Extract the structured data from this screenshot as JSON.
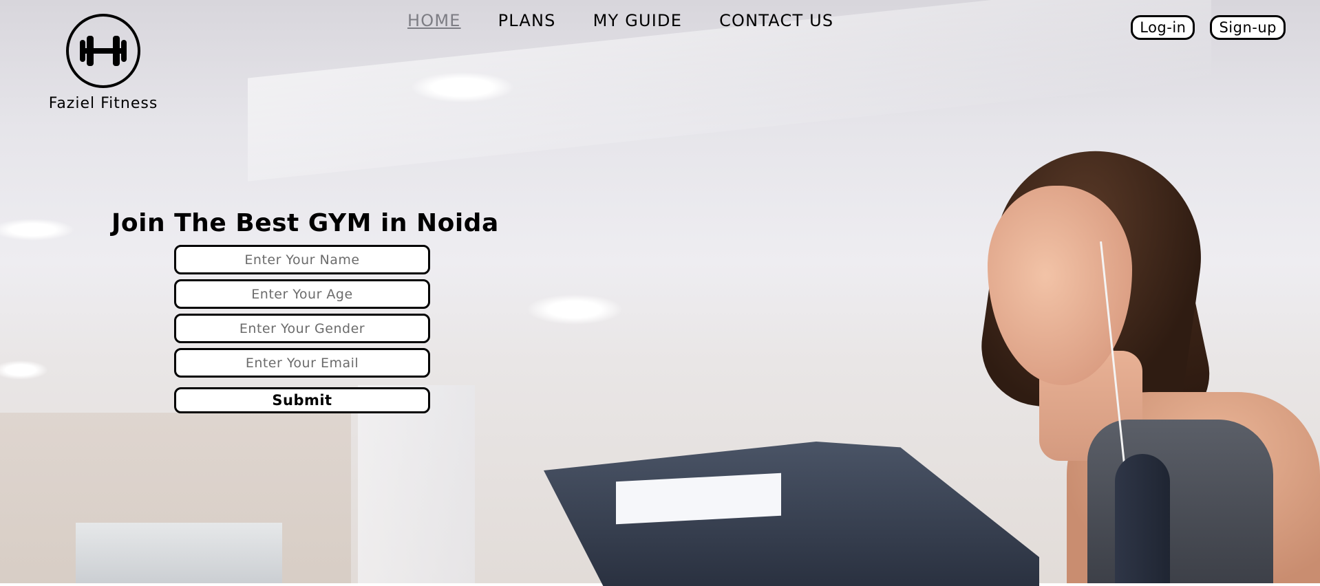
{
  "brand": {
    "name": "Faziel Fitness",
    "icon": "dumbbell-icon"
  },
  "nav": {
    "items": [
      {
        "label": "HOME",
        "active": true
      },
      {
        "label": "PLANS",
        "active": false
      },
      {
        "label": "MY GUIDE",
        "active": false
      },
      {
        "label": "CONTACT US",
        "active": false
      }
    ]
  },
  "auth": {
    "login_label": "Log-in",
    "signup_label": "Sign-up"
  },
  "hero": {
    "headline": "Join The Best GYM in Noida"
  },
  "form": {
    "name_placeholder": "Enter Your Name",
    "age_placeholder": "Enter Your Age",
    "gender_placeholder": "Enter Your Gender",
    "email_placeholder": "Enter Your Email",
    "submit_label": "Submit"
  },
  "colors": {
    "active_nav": "#7d7d84",
    "text": "#000000",
    "field_bg": "#ffffff"
  }
}
